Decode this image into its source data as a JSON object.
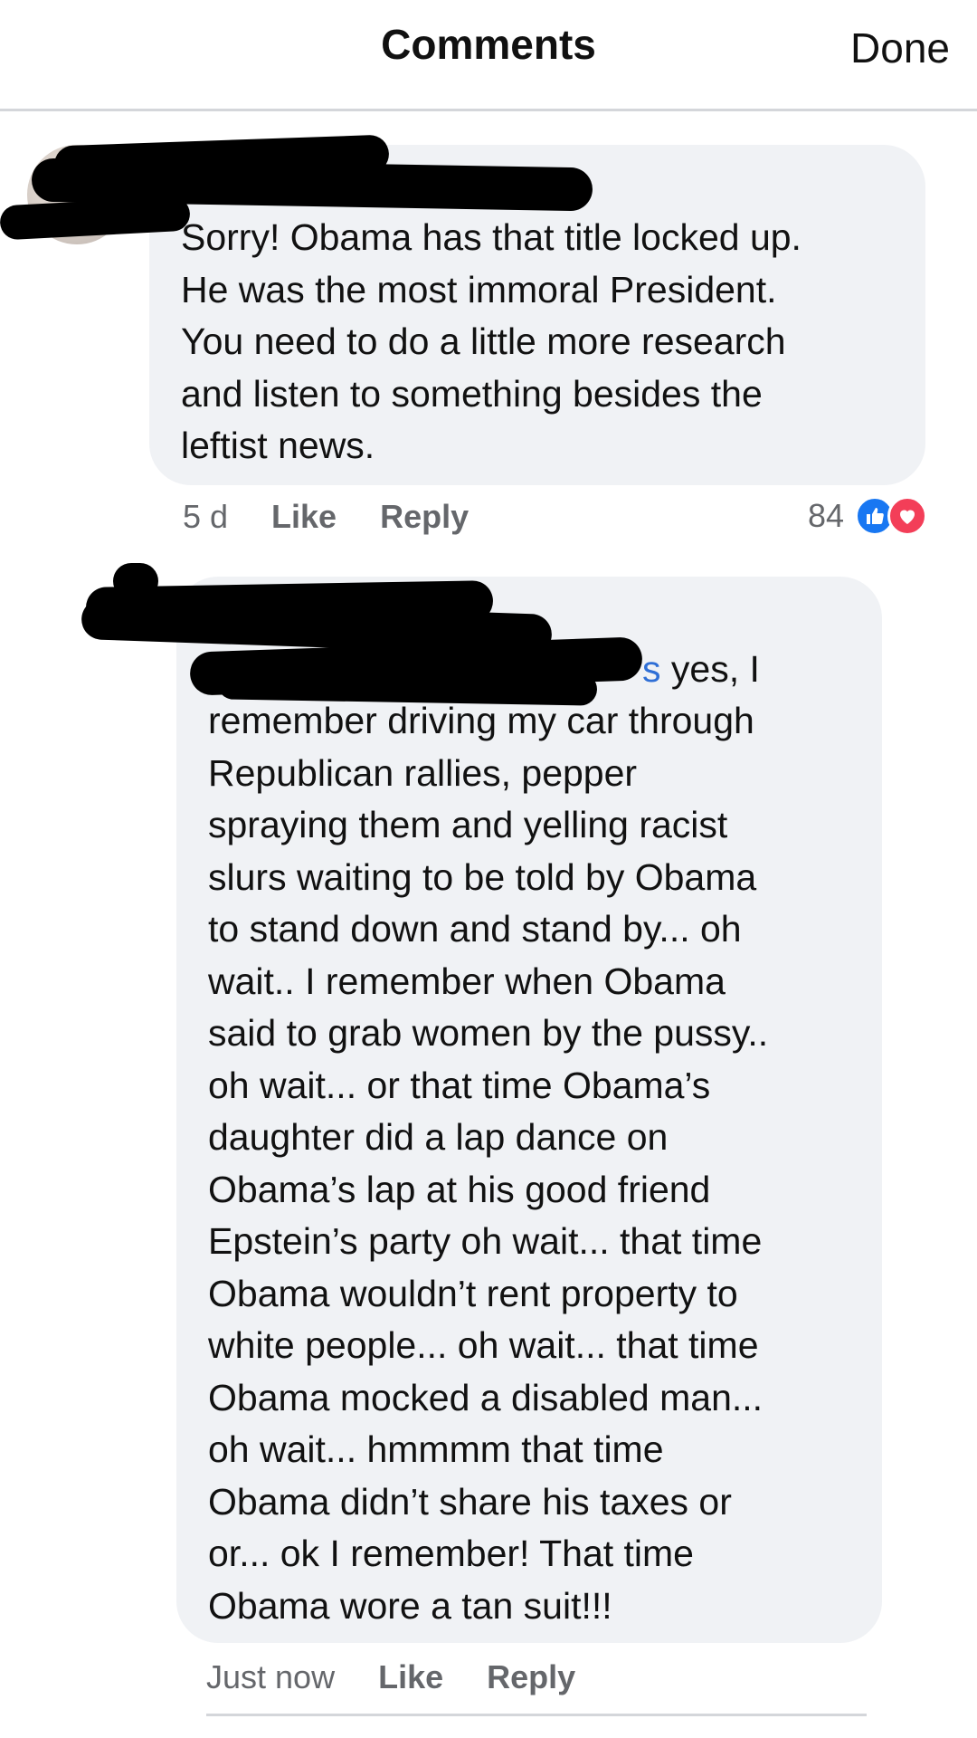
{
  "header": {
    "title": "Comments",
    "done_label": "Done"
  },
  "comments": [
    {
      "author": "",
      "text": "Sorry! Obama has that title locked up.\nHe was the most immoral President.\nYou need to do a little more research\nand listen to something besides the\nleftist news.",
      "time": "5 d",
      "like_label": "Like",
      "reply_label": "Reply",
      "reaction_count": "84",
      "reactions": [
        "like-icon",
        "love-icon"
      ]
    },
    {
      "author": "",
      "mention_tail": "s",
      "text_first_line": " yes, I",
      "text": "remember driving my car through\nRepublican rallies, pepper\nspraying them and yelling racist\nslurs waiting to be told by Obama\nto stand down and stand by... oh\nwait.. I remember when Obama\nsaid to grab women by the pussy..\noh wait... or that time Obama’s\ndaughter did a lap dance on\nObama’s lap at his good friend\nEpstein’s party oh wait... that time\nObama wouldn’t rent property to\nwhite people... oh wait... that time\nObama mocked a disabled man...\noh wait... hmmmm that time\nObama didn’t share his taxes or\nor... ok I remember! That time\nObama wore a tan suit!!!",
      "time": "Just now",
      "like_label": "Like",
      "reply_label": "Reply"
    }
  ],
  "colors": {
    "bubble": "#f0f2f5",
    "mention": "#2f6fd6",
    "like": "#1877f2",
    "love": "#f33e58",
    "meta": "#65676b"
  }
}
